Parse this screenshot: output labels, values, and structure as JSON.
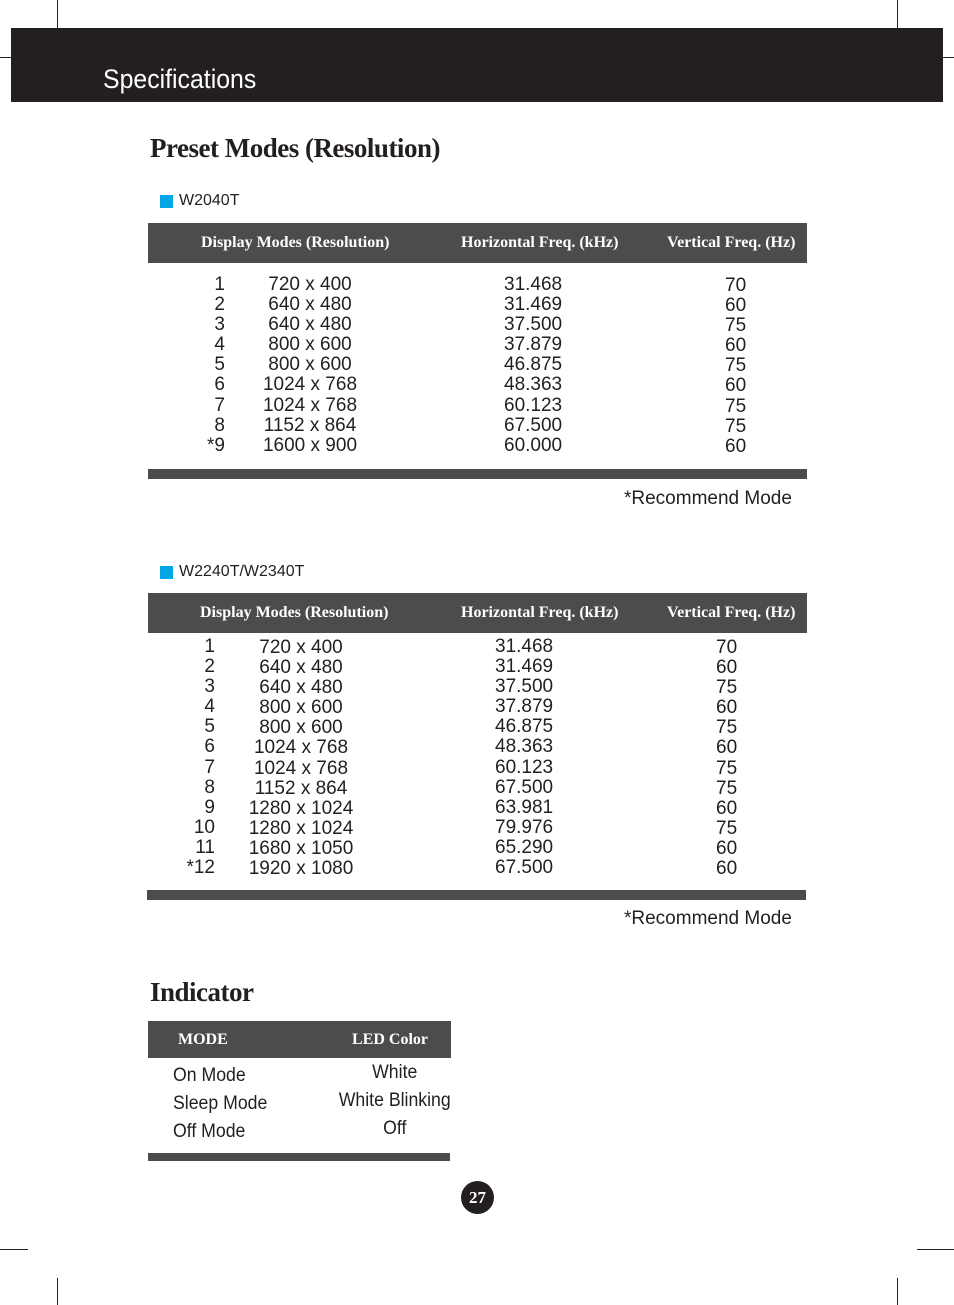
{
  "header": {
    "title": "Specifications"
  },
  "preset_section": {
    "title": "Preset Modes (Resolution)"
  },
  "tables": [
    {
      "model": "W2040T",
      "headers": [
        "Display Modes (Resolution)",
        "Horizontal Freq. (kHz)",
        "Vertical Freq. (Hz)"
      ],
      "rows": [
        {
          "no": "1",
          "resolution": "720 x 400",
          "h_freq": "31.468",
          "v_freq": "70"
        },
        {
          "no": "2",
          "resolution": "640 x 480",
          "h_freq": "31.469",
          "v_freq": "60"
        },
        {
          "no": "3",
          "resolution": "640 x 480",
          "h_freq": "37.500",
          "v_freq": "75"
        },
        {
          "no": "4",
          "resolution": "800 x 600",
          "h_freq": "37.879",
          "v_freq": "60"
        },
        {
          "no": "5",
          "resolution": "800 x 600",
          "h_freq": "46.875",
          "v_freq": "75"
        },
        {
          "no": "6",
          "resolution": "1024 x 768",
          "h_freq": "48.363",
          "v_freq": "60"
        },
        {
          "no": "7",
          "resolution": "1024 x 768",
          "h_freq": "60.123",
          "v_freq": "75"
        },
        {
          "no": "8",
          "resolution": "1152 x 864",
          "h_freq": "67.500",
          "v_freq": "75"
        },
        {
          "no": "*9",
          "resolution": "1600 x 900",
          "h_freq": "60.000",
          "v_freq": "60"
        }
      ],
      "note": "*Recommend Mode"
    },
    {
      "model": "W2240T/W2340T",
      "headers": [
        "Display Modes (Resolution)",
        "Horizontal Freq. (kHz)",
        "Vertical Freq. (Hz)"
      ],
      "rows": [
        {
          "no": "1",
          "resolution": "720 x 400",
          "h_freq": "31.468",
          "v_freq": "70"
        },
        {
          "no": "2",
          "resolution": "640 x 480",
          "h_freq": "31.469",
          "v_freq": "60"
        },
        {
          "no": "3",
          "resolution": "640 x 480",
          "h_freq": "37.500",
          "v_freq": "75"
        },
        {
          "no": "4",
          "resolution": "800 x 600",
          "h_freq": "37.879",
          "v_freq": "60"
        },
        {
          "no": "5",
          "resolution": "800 x 600",
          "h_freq": "46.875",
          "v_freq": "75"
        },
        {
          "no": "6",
          "resolution": "1024 x 768",
          "h_freq": "48.363",
          "v_freq": "60"
        },
        {
          "no": "7",
          "resolution": "1024 x 768",
          "h_freq": "60.123",
          "v_freq": "75"
        },
        {
          "no": "8",
          "resolution": "1152 x 864",
          "h_freq": "67.500",
          "v_freq": "75"
        },
        {
          "no": "9",
          "resolution": "1280 x 1024",
          "h_freq": "63.981",
          "v_freq": "60"
        },
        {
          "no": "10",
          "resolution": "1280 x 1024",
          "h_freq": "79.976",
          "v_freq": "75"
        },
        {
          "no": "11",
          "resolution": "1680 x 1050",
          "h_freq": "65.290",
          "v_freq": "60"
        },
        {
          "no": "*12",
          "resolution": "1920 x 1080",
          "h_freq": "67.500",
          "v_freq": "60"
        }
      ],
      "note": "*Recommend Mode"
    }
  ],
  "indicator": {
    "title": "Indicator",
    "headers": [
      "MODE",
      "LED Color"
    ],
    "rows": [
      {
        "mode": "On Mode",
        "led": "White"
      },
      {
        "mode": "Sleep Mode",
        "led": "White Blinking"
      },
      {
        "mode": "Off Mode",
        "led": "Off"
      }
    ]
  },
  "page_number": "27",
  "colors": {
    "header_bg": "#231f20",
    "table_header_bg": "#4d4b4c",
    "model_marker": "#00a6e6"
  }
}
